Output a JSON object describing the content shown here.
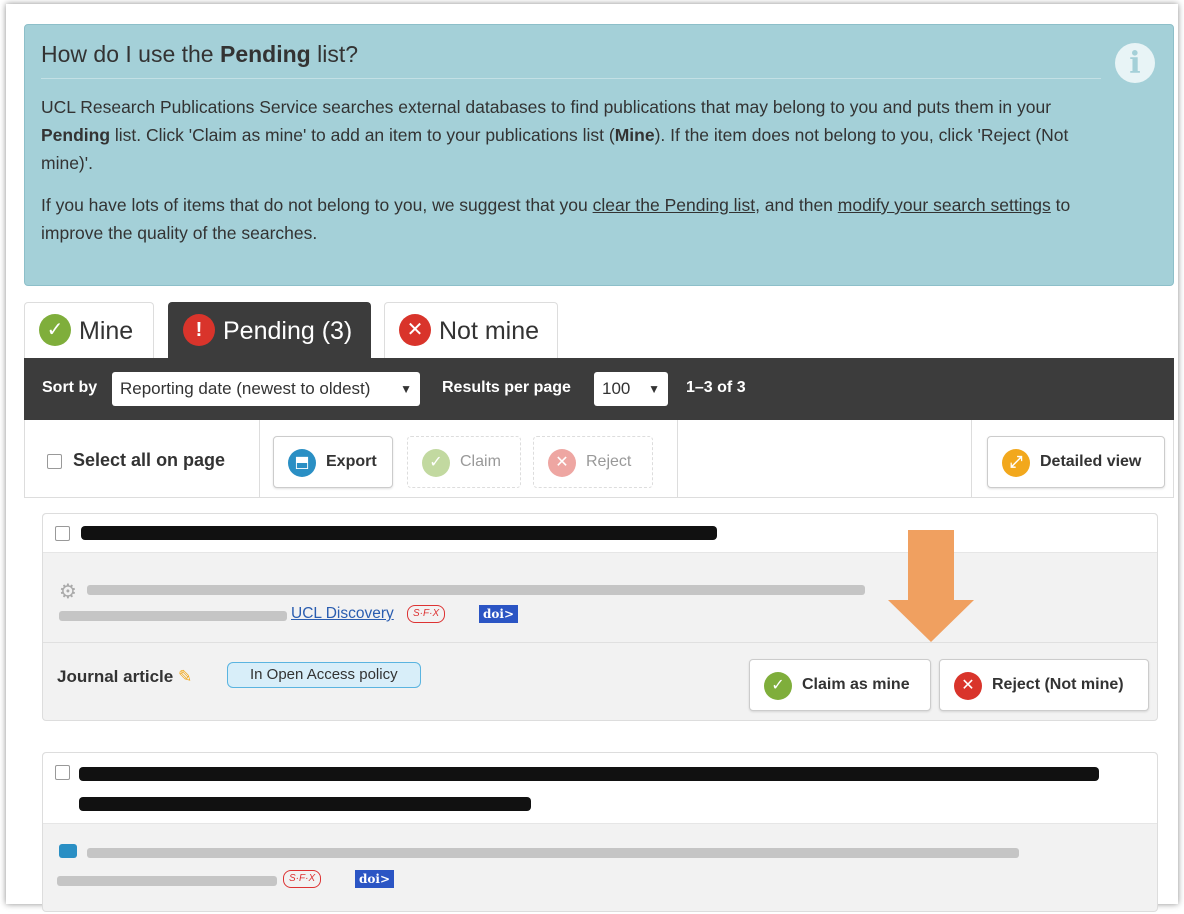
{
  "info": {
    "title_prefix": "How do I use the ",
    "title_bold": "Pending",
    "title_suffix": " list?",
    "p1_a": "UCL Research Publications Service searches external databases to find publications that may belong to you and puts them in your ",
    "p1_b": "Pending",
    "p1_c": " list. Click 'Claim as mine' to add an item to your publications list (",
    "p1_d": "Mine",
    "p1_e": "). If the item does not belong to you, click 'Reject (Not mine)'.",
    "p2_a": "If you have lots of items that do not belong to you, we suggest that you ",
    "p2_link1": "clear the Pending list",
    "p2_b": ", and then ",
    "p2_link2": "modify your search settings",
    "p2_c": " to improve the quality of the searches.",
    "icon": "info-icon"
  },
  "tabs": [
    {
      "label": "Mine",
      "icon": "check-icon",
      "color": "#7fae3b"
    },
    {
      "label": "Pending (3)",
      "icon": "exclamation-icon",
      "color": "#d9342b"
    },
    {
      "label": "Not mine",
      "icon": "x-icon",
      "color": "#d9342b"
    }
  ],
  "toolbar": {
    "sort_label": "Sort by",
    "sort_value": "Reporting date (newest to oldest)",
    "per_page_label": "Results per page",
    "per_page_value": "100",
    "range": "1–3 of 3"
  },
  "actions": {
    "select_all": "Select all on page",
    "export": "Export",
    "claim": "Claim",
    "reject": "Reject",
    "detailed_view": "Detailed view"
  },
  "publications": [
    {
      "type": "Journal article",
      "status": "In Open Access policy",
      "source_link": "UCL Discovery",
      "sfx": "S·F·X",
      "doi": "doi>",
      "claim": "Claim as mine",
      "reject": "Reject (Not mine)"
    },
    {
      "sfx": "S·F·X",
      "doi": "doi>"
    }
  ],
  "colors": {
    "info_bg": "#a4d0d8",
    "toolbar_bg": "#3c3c3c",
    "green": "#7fae3b",
    "red": "#d9342b",
    "blue": "#2a8fc4",
    "orange": "#f0a060"
  }
}
